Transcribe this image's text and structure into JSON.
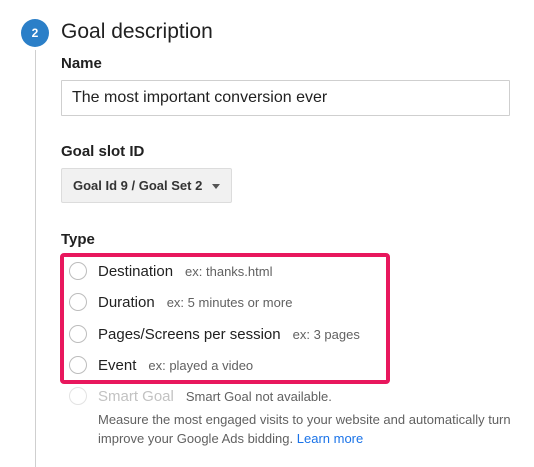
{
  "step": {
    "number": "2",
    "title": "Goal description"
  },
  "name_field": {
    "label": "Name",
    "value": "The most important conversion ever"
  },
  "goal_slot": {
    "label": "Goal slot ID",
    "selected": "Goal Id 9 / Goal Set 2"
  },
  "type": {
    "label": "Type",
    "options": [
      {
        "label": "Destination",
        "example": "ex: thanks.html"
      },
      {
        "label": "Duration",
        "example": "ex: 5 minutes or more"
      },
      {
        "label": "Pages/Screens per session",
        "example": "ex: 3 pages"
      },
      {
        "label": "Event",
        "example": "ex: played a video"
      }
    ],
    "smart_goal": {
      "label": "Smart Goal",
      "status": "Smart Goal not available.",
      "description_line1": "Measure the most engaged visits to your website and automatically turn",
      "description_line2": "improve your Google Ads bidding.",
      "learn_more": "Learn more"
    }
  },
  "colors": {
    "step_badge": "#2b7fc8",
    "highlight_border": "#e8175d",
    "link": "#1a73e8"
  }
}
